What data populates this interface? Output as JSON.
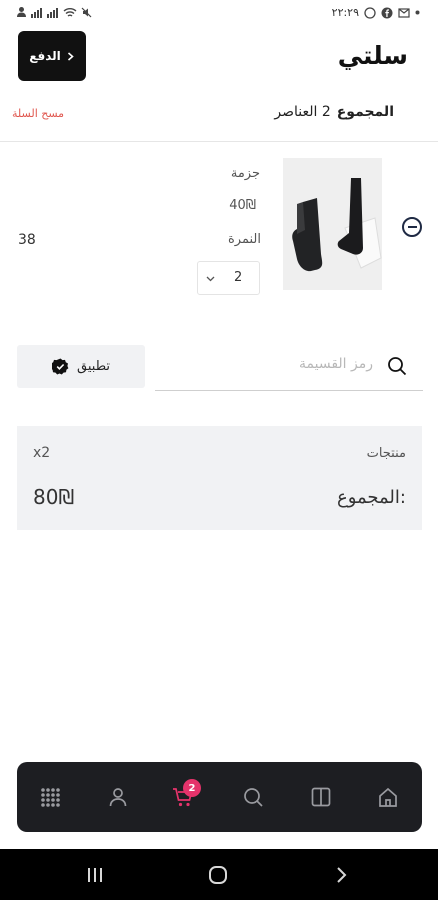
{
  "status_bar": {
    "time": "٢٢:٢٩",
    "icons": [
      "dot-icon",
      "mail-icon",
      "facebook-icon",
      "whatsapp-icon",
      "mute-icon",
      "wifi-icon",
      "signal-icon",
      "signal-icon",
      "account-icon"
    ]
  },
  "header": {
    "title": "سلتي",
    "checkout_label": "الدفع"
  },
  "summary": {
    "total_label": "المجموع",
    "items_text": "2 العناصر",
    "clear_cart": "مسح السلة"
  },
  "cart_item": {
    "name": "جزمة",
    "price": "40₪",
    "size_label": "النمرة",
    "size_value": "38",
    "quantity": "2"
  },
  "coupon": {
    "placeholder": "رمز القسيمة",
    "apply_label": "تطبيق"
  },
  "totals": {
    "products_label": "منتجات",
    "products_count": "x2",
    "total_label": "المجموع:",
    "total_value": "80₪"
  },
  "bottom_nav": {
    "items": [
      {
        "icon": "grid-icon"
      },
      {
        "icon": "user-icon"
      },
      {
        "icon": "cart-icon",
        "badge": "2"
      },
      {
        "icon": "search-icon"
      },
      {
        "icon": "columns-icon"
      },
      {
        "icon": "home-icon"
      }
    ],
    "cart_color": "#e5336b"
  },
  "colors": {
    "accent_dark": "#111111",
    "danger": "#e0574f",
    "card_bg": "#f1f2f4",
    "nav_bg": "#1d1e22"
  }
}
